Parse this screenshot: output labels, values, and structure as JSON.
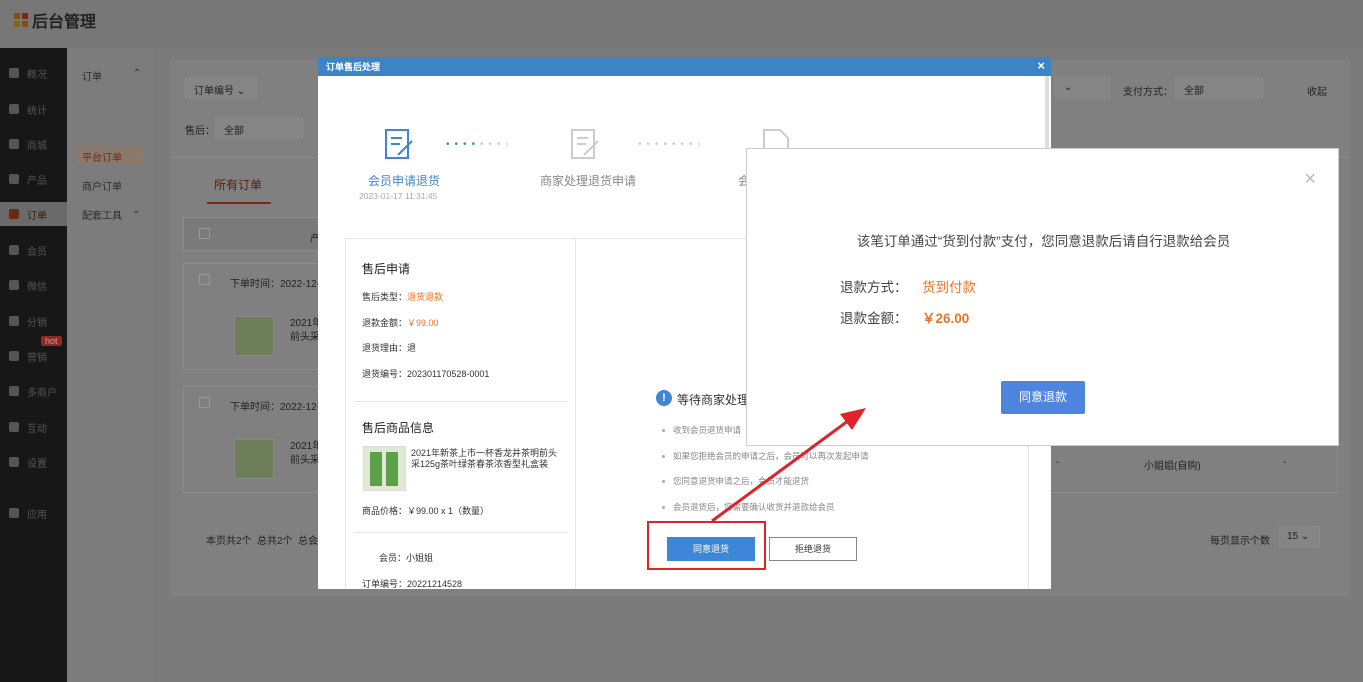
{
  "app": {
    "title": "后台管理",
    "logo_icon": "grid-logo-icon"
  },
  "colors": {
    "accent": "#3e86d6",
    "orange": "#e8742a",
    "highlight": "#e0222a",
    "header": "#3d84c7"
  },
  "nav": {
    "items": [
      {
        "label": "概况",
        "icon": "graduation-icon"
      },
      {
        "label": "统计",
        "icon": "chart-icon"
      },
      {
        "label": "商城",
        "icon": "store-icon"
      },
      {
        "label": "产品",
        "icon": "grid-icon"
      },
      {
        "label": "订单",
        "icon": "order-icon"
      },
      {
        "label": "会员",
        "icon": "crown-icon"
      },
      {
        "label": "微信",
        "icon": "wechat-icon"
      },
      {
        "label": "分销",
        "icon": "user-share-icon"
      },
      {
        "label": "营销",
        "icon": "flag-icon"
      },
      {
        "label": "多商户",
        "icon": "multi-store-icon"
      },
      {
        "label": "互动",
        "icon": "interact-icon"
      },
      {
        "label": "设置",
        "icon": "gear-icon"
      },
      {
        "label": "应用",
        "icon": "apps-icon"
      }
    ],
    "hot_badge": "hot"
  },
  "subnav": {
    "group": "订单",
    "items": [
      "平台订单",
      "商户订单"
    ],
    "tools": "配套工具"
  },
  "filters": {
    "order_no": "订单编号",
    "after_sale_label": "售后：",
    "after_sale_value": "全部",
    "pay_label": "支付方式：",
    "pay_value": "全部",
    "collapse": "收起"
  },
  "orders": {
    "tab_all": "所有订单",
    "col_product": "产",
    "rows": [
      {
        "time": "下单时间：2022-12-",
        "name_a": "2021年",
        "name_b": "前头采"
      },
      {
        "time": "下单时间：2022-12-",
        "name_a": "2021年",
        "name_b": "前头采",
        "member": "小姐姐(自购)",
        "dash": "-"
      }
    ],
    "row_dash": "-",
    "footer": {
      "page_info": "本页共2个",
      "total": "总共2个",
      "total2": "总会",
      "page_size_label": "每页显示个数",
      "page_size": "15"
    }
  },
  "modal": {
    "title": "订单售后处理",
    "close": "×",
    "steps": [
      {
        "label": "会员申请退货",
        "time": "2023-01-17 11:31:45"
      },
      {
        "label": "商家处理退货申请",
        "time": ""
      },
      {
        "label": "会",
        "time": ""
      }
    ],
    "left": {
      "apply_title": "售后申请",
      "type_label": "售后类型：",
      "type_value": "退货退款",
      "amount_label": "退款金额：",
      "amount_value": "￥99.00",
      "reason_label": "退货理由：",
      "reason_value": "退",
      "no_label": "退货编号：",
      "no_value": "202301170528-0001",
      "goods_title": "售后商品信息",
      "goods_name": "2021年新茶上市一杯香龙井茶明前头采125g茶叶绿茶春茶浓香型礼盒装",
      "price_line": "商品价格：￥99.00 x 1（数量）",
      "member_line": "会员：小姐姐",
      "order_line": "订单编号：20221214528"
    },
    "right": {
      "status": "等待商家处理",
      "hints": [
        "收到会员退货申请",
        "如果您拒绝会员的申请之后，会员可以再次发起申请",
        "您同意退货申请之后，会员才能退货",
        "会员退货后，您需要确认收货并退款给会员"
      ],
      "agree_btn": "同意退货",
      "reject_btn": "拒绝退货"
    }
  },
  "popup": {
    "message": "该笔订单通过“货到付款”支付，您同意退款后请自行退款给会员",
    "method_label": "退款方式：",
    "method_value": "货到付款",
    "amount_label": "退款金额：",
    "amount_value": "￥26.00",
    "confirm_btn": "同意退款",
    "close": "×"
  }
}
